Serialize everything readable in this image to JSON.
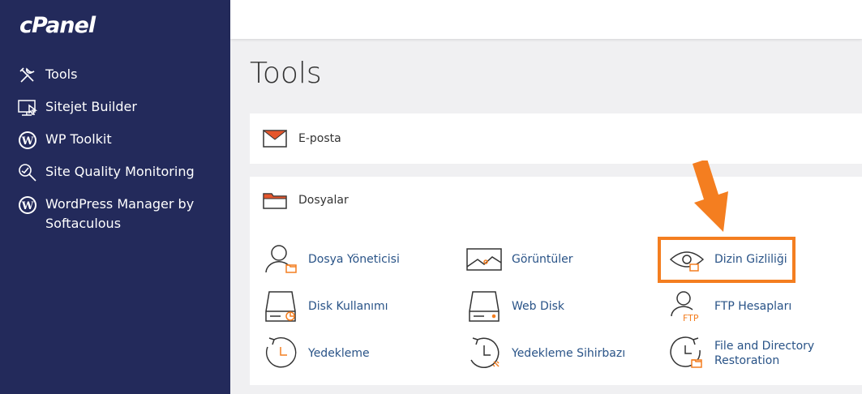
{
  "brand": {
    "logo_text": "cPanel"
  },
  "sidebar": {
    "items": [
      {
        "label": "Tools",
        "icon": "tools-icon"
      },
      {
        "label": "Sitejet Builder",
        "icon": "sitejet-icon"
      },
      {
        "label": "WP Toolkit",
        "icon": "wordpress-icon"
      },
      {
        "label": "Site Quality Monitoring",
        "icon": "magnifier-icon"
      },
      {
        "label": "WordPress Manager by Softaculous",
        "icon": "wordpress-icon"
      }
    ]
  },
  "main": {
    "title": "Tools",
    "sections": {
      "email": {
        "label": "E-posta",
        "icon": "envelope-icon"
      },
      "files": {
        "label": "Dosyalar",
        "icon": "folder-icon",
        "apps": [
          {
            "label": "Dosya Yöneticisi",
            "icon": "file-manager-icon"
          },
          {
            "label": "Görüntüler",
            "icon": "images-icon"
          },
          {
            "label": "Dizin Gizliliği",
            "icon": "directory-privacy-icon"
          },
          {
            "label": "Disk Kullanımı",
            "icon": "disk-usage-icon"
          },
          {
            "label": "Web Disk",
            "icon": "web-disk-icon"
          },
          {
            "label": "FTP Hesapları",
            "icon": "ftp-accounts-icon"
          },
          {
            "label": "Yedekleme",
            "icon": "backup-icon"
          },
          {
            "label": "Yedekleme Sihirbazı",
            "icon": "backup-wizard-icon"
          },
          {
            "label": "File and Directory Restoration",
            "icon": "restore-icon"
          }
        ]
      }
    }
  },
  "annotation": {
    "color": "#f47e20",
    "target": "Dizin Gizliliği"
  },
  "colors": {
    "sidebar": "#232a5b",
    "link": "#295387",
    "accent": "#f47e20"
  }
}
